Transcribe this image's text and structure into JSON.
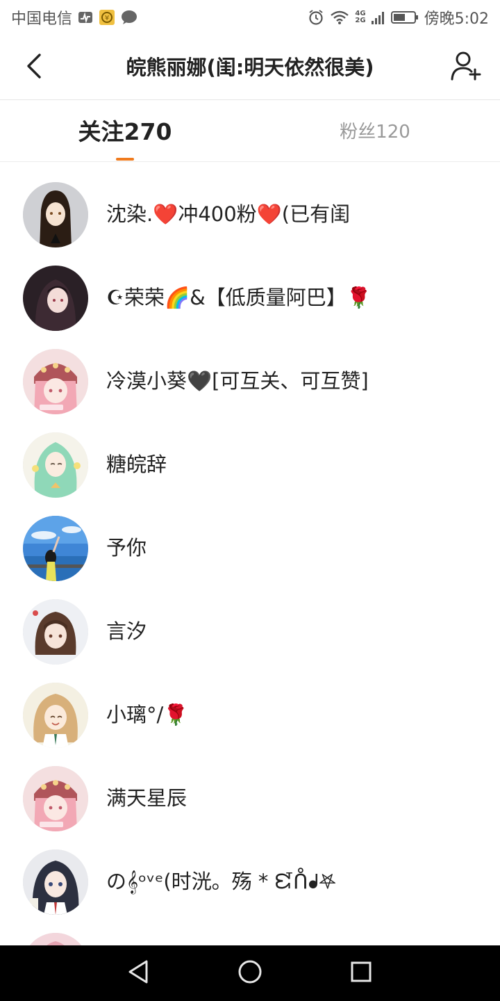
{
  "status_bar": {
    "carrier": "中国电信",
    "network_top": "4G",
    "network_bottom": "2G",
    "time": "傍晚5:02",
    "icons": [
      "activity-icon",
      "coin-icon",
      "chat-bubble-icon",
      "alarm-icon",
      "wifi-icon",
      "signal-icon",
      "battery-icon"
    ]
  },
  "header": {
    "title": "皖熊丽娜(闺:明天依然很美)",
    "back_icon": "chevron-left-icon",
    "add_icon": "add-user-icon"
  },
  "tabs": {
    "following": "关注270",
    "fans": "粉丝120",
    "active": "following",
    "accent_color": "#f07b1e"
  },
  "users": [
    {
      "name": "沈染.❤️冲400粉❤️(已有闺"
    },
    {
      "name": "☪荣荣🌈&【低质量阿巴】🌹"
    },
    {
      "name": "冷漠小葵🖤[可互关、可互赞]"
    },
    {
      "name": "糖皖辞"
    },
    {
      "name": "予你"
    },
    {
      "name": "言汐"
    },
    {
      "name": "小璃°/🌹"
    },
    {
      "name": "满天星辰"
    },
    {
      "name": "の𝄞ᵒᵛᵉ(时洸。殇 * ᘿᑍᖱ𖤐"
    },
    {
      "name": ""
    }
  ],
  "nav_bar": {
    "icons": [
      "back-triangle-icon",
      "home-circle-icon",
      "recents-square-icon"
    ]
  }
}
